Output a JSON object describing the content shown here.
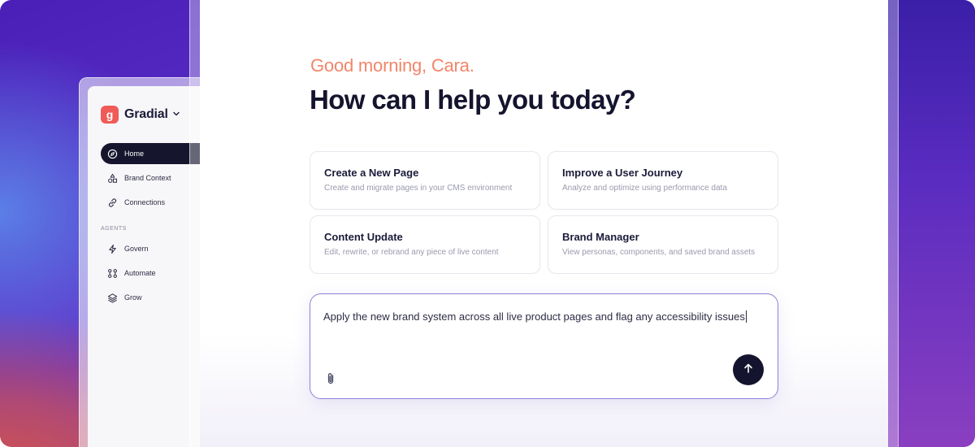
{
  "sidebar": {
    "brand_name": "Gradial",
    "brand_letter": "g",
    "items": [
      {
        "label": "Home",
        "icon": "compass-icon",
        "active": true
      },
      {
        "label": "Brand Context",
        "icon": "shapes-icon"
      },
      {
        "label": "Connections",
        "icon": "link-icon"
      }
    ],
    "section_label": "AGENTS",
    "agents": [
      {
        "label": "Govern",
        "icon": "lightning-icon"
      },
      {
        "label": "Automate",
        "icon": "workflow-icon"
      },
      {
        "label": "Grow",
        "icon": "layers-icon"
      }
    ]
  },
  "main": {
    "greeting": "Good morning, Cara.",
    "headline": "How can I help you today?",
    "cards": [
      {
        "title": "Create a New Page",
        "desc": "Create and migrate pages in your CMS environment"
      },
      {
        "title": "Improve a User Journey",
        "desc": "Analyze and optimize using performance data"
      },
      {
        "title": "Content Update",
        "desc": "Edit, rewrite, or rebrand any piece of live content"
      },
      {
        "title": "Brand Manager",
        "desc": "View personas, components, and saved brand assets"
      }
    ],
    "composer": {
      "text": "Apply the new brand system across all live product pages and flag any accessibility issues",
      "attach_icon": "paperclip-icon",
      "send_icon": "arrow-up-icon"
    }
  },
  "colors": {
    "accent": "#ef5b57",
    "greeting": "#f2856a",
    "dark": "#14142e",
    "composer_border": "#8f7fd8"
  }
}
